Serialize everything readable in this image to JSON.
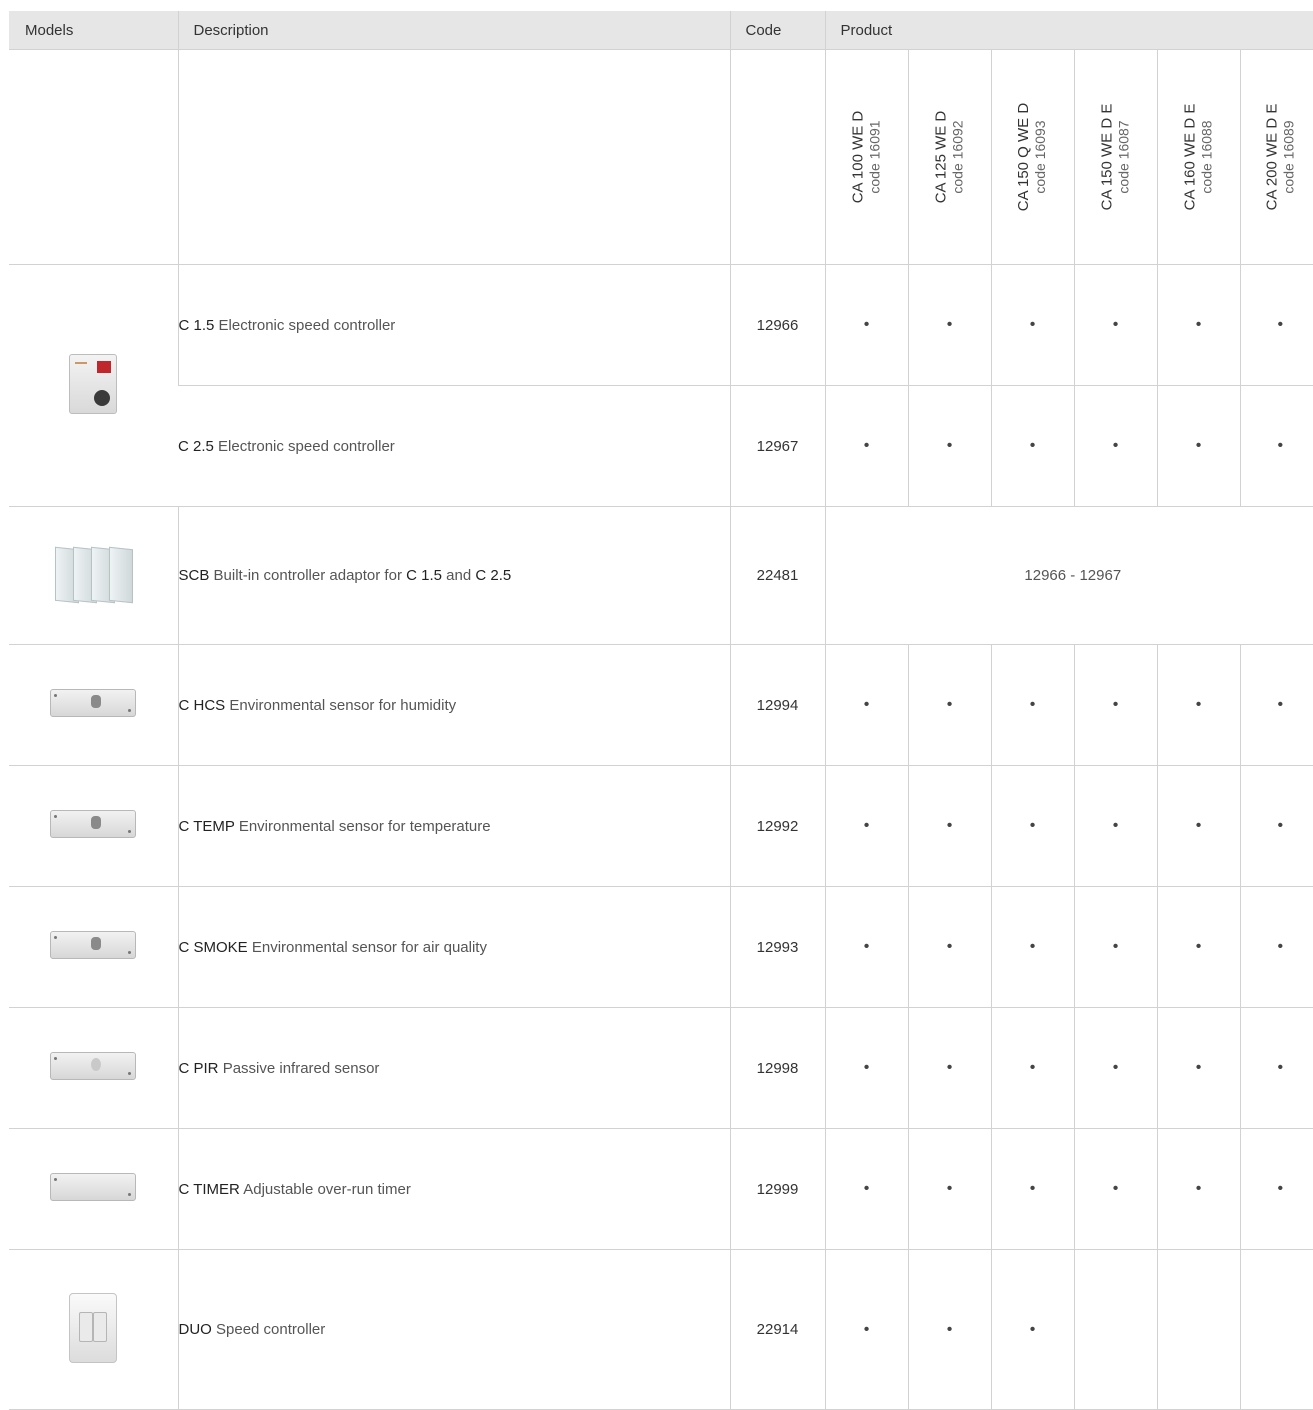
{
  "headers": {
    "models": "Models",
    "description": "Description",
    "code": "Code",
    "product": "Product"
  },
  "products": [
    {
      "model": "CA 100 WE D",
      "code": "code 16091"
    },
    {
      "model": "CA 125 WE D",
      "code": "code 16092"
    },
    {
      "model": "CA 150 Q WE D",
      "code": "code 16093"
    },
    {
      "model": "CA 150 WE D E",
      "code": "code 16087"
    },
    {
      "model": "CA 160 WE D E",
      "code": "code 16088"
    },
    {
      "model": "CA 200 WE D E",
      "code": "code 16089"
    }
  ],
  "rows": [
    {
      "name": "C 1.5",
      "desc": "Electronic speed controller",
      "code": "12966",
      "dots": [
        true,
        true,
        true,
        true,
        true,
        true
      ],
      "image": "speed-controller"
    },
    {
      "name": "C 2.5",
      "desc": "Electronic speed controller",
      "code": "12967",
      "dots": [
        true,
        true,
        true,
        true,
        true,
        true
      ],
      "image": null
    },
    {
      "name": "SCB",
      "desc_parts": [
        "Built-in controller adaptor for",
        "C 1.5",
        "and",
        "C 2.5"
      ],
      "code": "22481",
      "span_text": "12966 - 12967",
      "image": "controller-adaptor"
    },
    {
      "name": "C HCS",
      "desc": "Environmental sensor for humidity",
      "code": "12994",
      "dots": [
        true,
        true,
        true,
        true,
        true,
        true
      ],
      "image": "sensor-box"
    },
    {
      "name": "C TEMP",
      "desc": "Environmental sensor for temperature",
      "code": "12992",
      "dots": [
        true,
        true,
        true,
        true,
        true,
        true
      ],
      "image": "sensor-box"
    },
    {
      "name": "C SMOKE",
      "desc": "Environmental sensor for air quality",
      "code": "12993",
      "dots": [
        true,
        true,
        true,
        true,
        true,
        true
      ],
      "image": "sensor-box"
    },
    {
      "name": "C PIR",
      "desc": "Passive infrared sensor",
      "code": "12998",
      "dots": [
        true,
        true,
        true,
        true,
        true,
        true
      ],
      "image": "pir-sensor"
    },
    {
      "name": "C TIMER",
      "desc": "Adjustable over-run timer",
      "code": "12999",
      "dots": [
        true,
        true,
        true,
        true,
        true,
        true
      ],
      "image": "timer-box"
    },
    {
      "name": "DUO",
      "desc": "Speed controller",
      "code": "22914",
      "dots": [
        true,
        true,
        true,
        false,
        false,
        false
      ],
      "image": "duo-controller"
    }
  ],
  "bullet": "•"
}
